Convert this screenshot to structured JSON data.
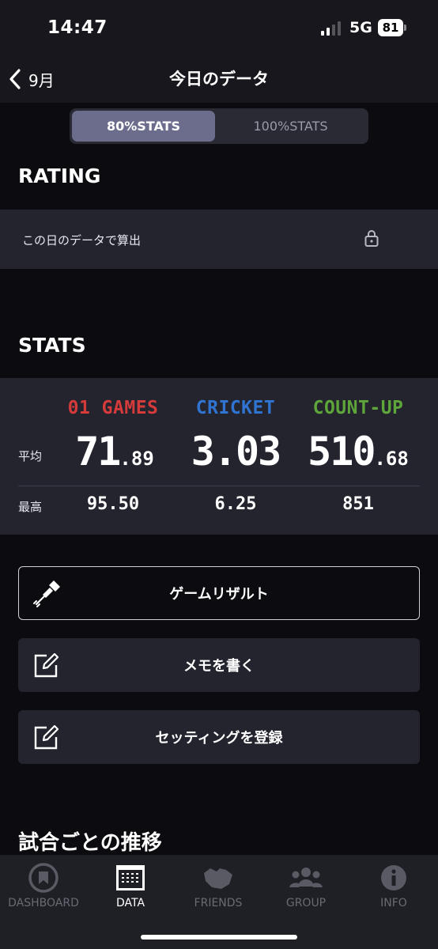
{
  "status": {
    "time": "14:47",
    "network": "5G",
    "battery": "81"
  },
  "nav": {
    "back_label": "9月",
    "title": "今日のデータ"
  },
  "segments": {
    "active": "80%STATS",
    "inactive": "100%STATS"
  },
  "rating": {
    "title": "RATING",
    "text": "この日のデータで算出"
  },
  "stats": {
    "title": "STATS",
    "avg_label": "平均",
    "max_label": "最高",
    "games": [
      {
        "name": "01 GAMES",
        "color": "#d63b3b",
        "avg_int": "71",
        "avg_dec": ".89",
        "max": "95.50"
      },
      {
        "name": "CRICKET",
        "color": "#2f74d0",
        "avg_int": "3.03",
        "avg_dec": "",
        "max": "6.25"
      },
      {
        "name": "COUNT-UP",
        "color": "#5ea53a",
        "avg_int": "510",
        "avg_dec": ".68",
        "max": "851"
      }
    ]
  },
  "actions": {
    "game_result": "ゲームリザルト",
    "memo": "メモを書く",
    "setting": "セッティングを登録"
  },
  "transition_title": "試合ごとの推移",
  "tabs": [
    {
      "label": "DASHBOARD"
    },
    {
      "label": "DATA"
    },
    {
      "label": "FRIENDS"
    },
    {
      "label": "GROUP"
    },
    {
      "label": "INFO"
    }
  ]
}
